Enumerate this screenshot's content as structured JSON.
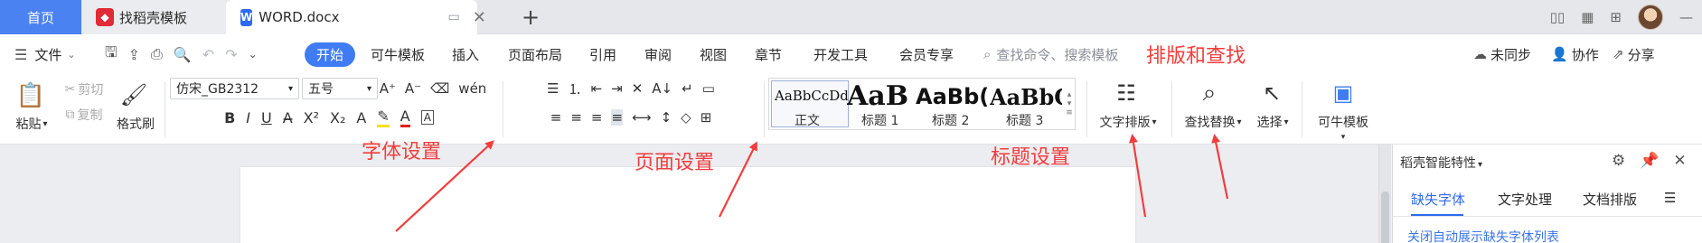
{
  "tabs": {
    "home": "首页",
    "templates": "找稻壳模板",
    "document": "WORD.docx"
  },
  "menu": {
    "file": "文件",
    "items": [
      "开始",
      "可牛模板",
      "插入",
      "页面布局",
      "引用",
      "审阅",
      "视图",
      "章节",
      "开发工具",
      "会员专享"
    ],
    "search_placeholder": "查找命令、搜索模板",
    "sync": "未同步",
    "collab": "协作",
    "share": "分享"
  },
  "ribbon": {
    "paste": "粘贴",
    "cut": "剪切",
    "copy": "复制",
    "format_painter": "格式刷",
    "font_name": "仿宋_GB2312",
    "font_size": "五号",
    "styles": [
      {
        "sample": "AaBbCcDd",
        "label": "正文"
      },
      {
        "sample": "AaB",
        "label": "标题 1"
      },
      {
        "sample": "AaBb(",
        "label": "标题 2"
      },
      {
        "sample": "AaBbC",
        "label": "标题 3"
      }
    ],
    "text_layout": "文字排版",
    "find_replace": "查找替换",
    "select": "选择",
    "keniu_template": "可牛模板"
  },
  "panel": {
    "title": "稻壳智能特性",
    "tabs": [
      "缺失字体",
      "文字处理",
      "文档排版"
    ],
    "link": "关闭自动展示缺失字体列表"
  },
  "annotations": {
    "layout_find": "排版和查找",
    "font_settings": "字体设置",
    "page_settings": "页面设置",
    "heading_settings": "标题设置"
  },
  "colors": {
    "accent": "#3f7cf4",
    "annotation": "#f23d3d"
  }
}
